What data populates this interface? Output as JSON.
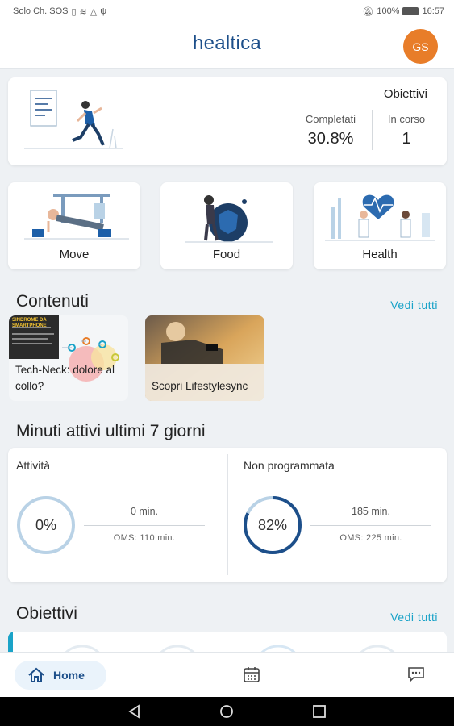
{
  "status_bar": {
    "carrier": "Solo Ch. SOS",
    "battery": "100%",
    "time": "16:57"
  },
  "header": {
    "logo": "healtica",
    "avatar_initials": "GS",
    "avatar_color": "#e87d29"
  },
  "goals_summary": {
    "title": "Obiettivi",
    "completed_label": "Completati",
    "completed_value": "30.8%",
    "in_progress_label": "In corso",
    "in_progress_value": "1"
  },
  "categories": [
    {
      "label": "Move"
    },
    {
      "label": "Food"
    },
    {
      "label": "Health"
    }
  ],
  "contents_section": {
    "title": "Contenuti",
    "see_all": "Vedi tutti",
    "items": [
      {
        "title": "Tech-Neck: dolore al collo?",
        "thumb_heading": "SINDROME DA SMARTPHONE"
      },
      {
        "title": "Scopri Lifestylesync"
      }
    ]
  },
  "active_minutes": {
    "title": "Minuti attivi ultimi 7 giorni",
    "cards": [
      {
        "title": "Attività",
        "percent": "0%",
        "percent_value": 0,
        "minutes": "0 min.",
        "oms": "OMS: 110 min."
      },
      {
        "title": "Non programmata",
        "percent": "82%",
        "percent_value": 82,
        "minutes": "185 min.",
        "oms": "OMS: 225 min."
      }
    ]
  },
  "objectives_section": {
    "title": "Obiettivi",
    "see_all": "Vedi tutti"
  },
  "bottom_nav": {
    "home_label": "Home",
    "items": [
      "home-icon",
      "calendar-icon",
      "chat-icon"
    ]
  },
  "colors": {
    "brand": "#1d4f8a",
    "accent": "#1aa3c8",
    "ring": "#1d4f8a",
    "ring_track": "#b9d2e6"
  }
}
